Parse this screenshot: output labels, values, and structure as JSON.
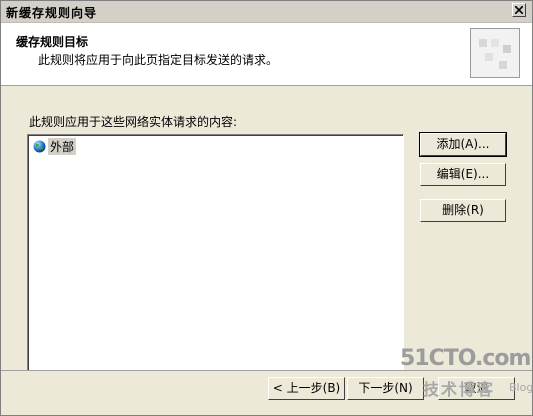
{
  "window": {
    "title": "新缓存规则向导"
  },
  "header": {
    "title": "缓存规则目标",
    "subtitle": "此规则将应用于向此页指定目标发送的请求。"
  },
  "main": {
    "list_label": "此规则应用于这些网络实体请求的内容:",
    "list_items": [
      {
        "label": "外部",
        "icon": "globe-icon"
      }
    ],
    "buttons": {
      "add": "添加(A)...",
      "edit": "编辑(E)...",
      "delete": "删除(R)"
    }
  },
  "footer": {
    "back": "< 上一步(B)",
    "next": "下一步(N)",
    "finish": "取消"
  },
  "watermark": {
    "main": "51CTO.com",
    "sub": "技术博客",
    "blog": "Blog"
  }
}
